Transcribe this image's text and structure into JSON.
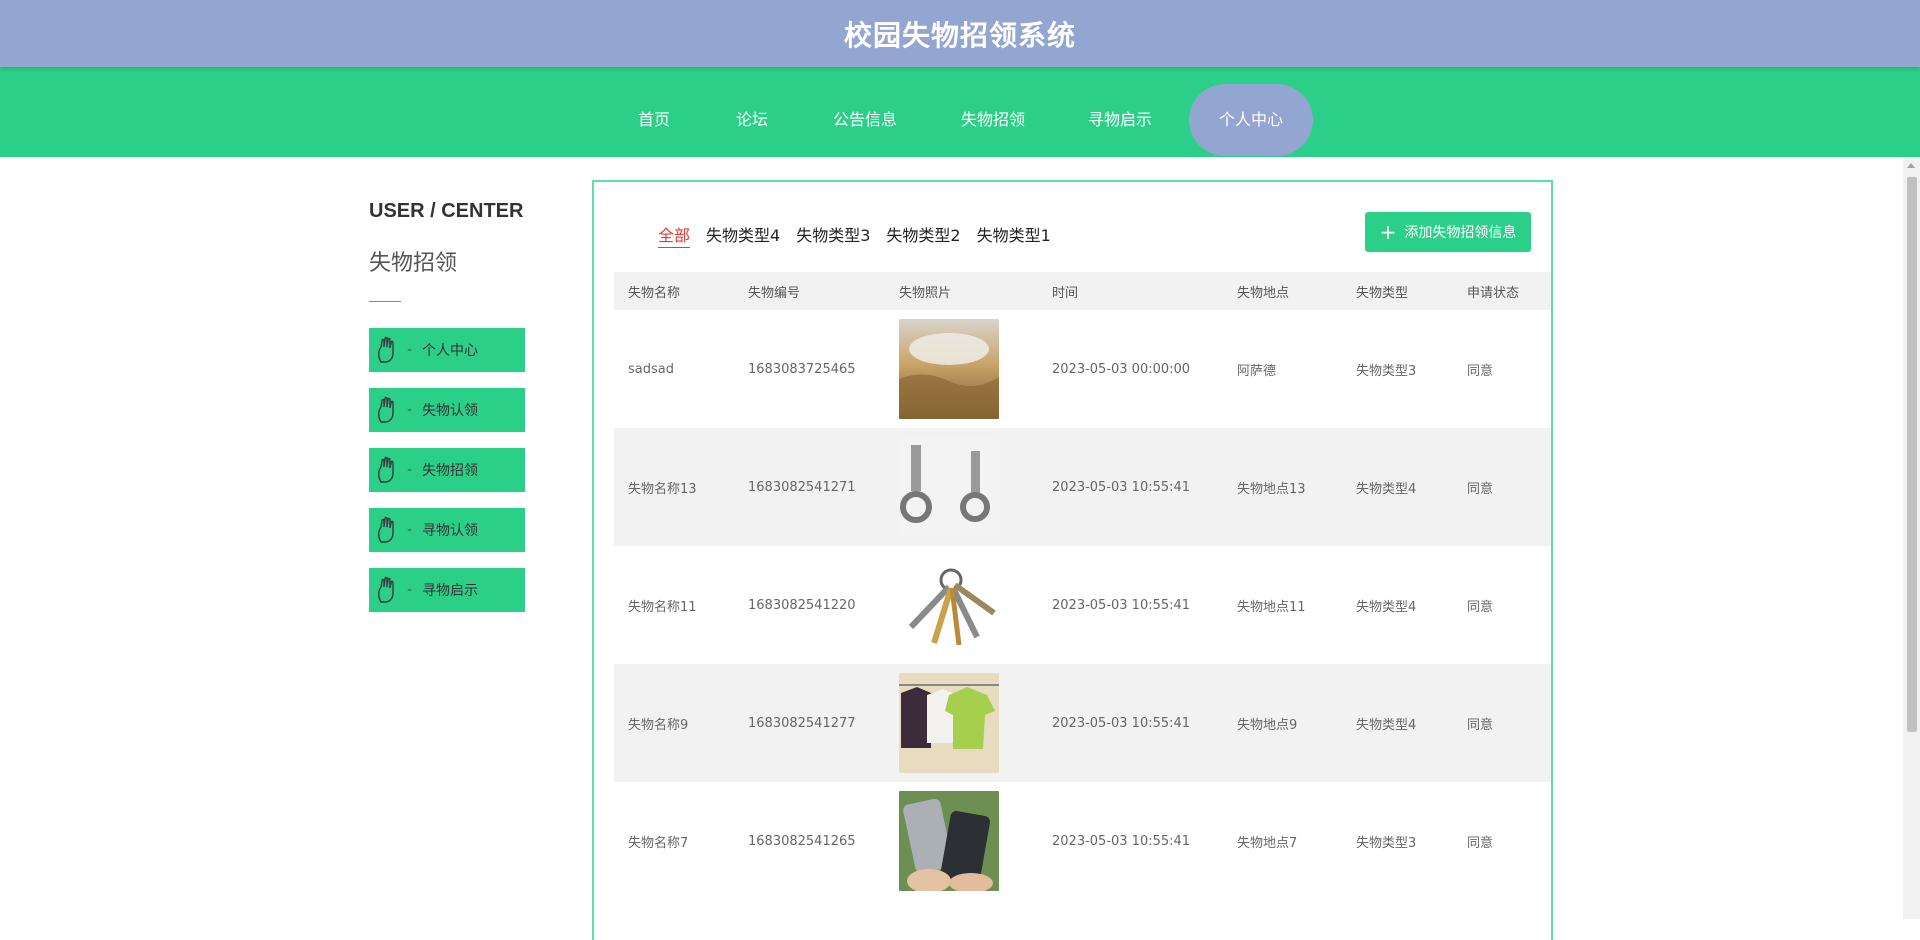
{
  "header": {
    "title": "校园失物招领系统"
  },
  "nav": {
    "items": [
      "首页",
      "论坛",
      "公告信息",
      "失物招领",
      "寻物启示",
      "个人中心"
    ],
    "active": "个人中心",
    "accent_color": "#2bcf88",
    "active_color": "#93a5d1"
  },
  "sidebar": {
    "heading": "USER / CENTER",
    "subheading": "失物招领",
    "items": [
      {
        "label": "个人中心",
        "icon": "hand-icon"
      },
      {
        "label": "失物认领",
        "icon": "hand-icon"
      },
      {
        "label": "失物招领",
        "icon": "hand-icon"
      },
      {
        "label": "寻物认领",
        "icon": "hand-icon"
      },
      {
        "label": "寻物启示",
        "icon": "hand-icon"
      }
    ],
    "dash": "-"
  },
  "filters": {
    "tabs": [
      "全部",
      "失物类型4",
      "失物类型3",
      "失物类型2",
      "失物类型1"
    ],
    "active": "全部"
  },
  "toolbar": {
    "add_label": "添加失物招领信息",
    "add_icon": "plus-icon"
  },
  "table": {
    "headers": [
      "失物名称",
      "失物编号",
      "失物照片",
      "时间",
      "失物地点",
      "失物类型",
      "申请状态"
    ],
    "rows": [
      {
        "name": "sadsad",
        "code": "1683083725465",
        "photo": "waterfall-photo",
        "time": "2023-05-03 00:00:00",
        "place": "阿萨德",
        "type": "失物类型3",
        "status": "同意"
      },
      {
        "name": "失物名称13",
        "code": "1683082541271",
        "photo": "keys-photo",
        "time": "2023-05-03 10:55:41",
        "place": "失物地点13",
        "type": "失物类型4",
        "status": "同意"
      },
      {
        "name": "失物名称11",
        "code": "1683082541220",
        "photo": "keyring-photo",
        "time": "2023-05-03 10:55:41",
        "place": "失物地点11",
        "type": "失物类型4",
        "status": "同意"
      },
      {
        "name": "失物名称9",
        "code": "1683082541277",
        "photo": "tshirts-photo",
        "time": "2023-05-03 10:55:41",
        "place": "失物地点9",
        "type": "失物类型4",
        "status": "同意"
      },
      {
        "name": "失物名称7",
        "code": "1683082541265",
        "photo": "phones-photo",
        "time": "2023-05-03 10:55:41",
        "place": "失物地点7",
        "type": "失物类型3",
        "status": "同意"
      }
    ]
  }
}
